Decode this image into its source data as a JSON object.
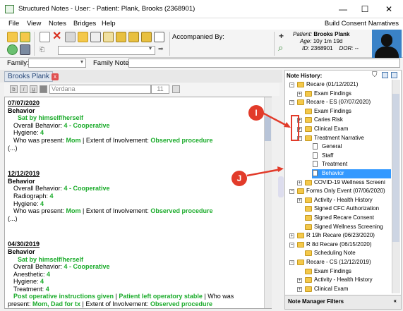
{
  "window": {
    "title": "Structured Notes - User:  - Patient: Plank, Brooks (2368901)",
    "minimize": "—",
    "maximize": "☐",
    "close": "✕"
  },
  "menu": {
    "items": [
      "File",
      "View",
      "Notes",
      "Bridges",
      "Help"
    ],
    "right_text": "Build Consent Narratives"
  },
  "toolbar": {
    "accompanied_by_label": "Accompanied By:"
  },
  "patient": {
    "patient_label": "Patient:",
    "patient_name": "Brooks Plank",
    "age_label": "Age:",
    "age_value": "10y 1m 19d",
    "id_label": "ID:",
    "id_value": "2368901",
    "dor_label": "DOR:",
    "dor_value": "--"
  },
  "family_row": {
    "family_label": "Family:",
    "family_note_label": "Family Note:"
  },
  "document_tab": {
    "label": "Brooks Plank",
    "close": "x"
  },
  "editor_toolbar": {
    "bold": "b",
    "italic": "i",
    "underline": "u",
    "font": "Verdana",
    "font_size": "11"
  },
  "notes": [
    {
      "date": "07/07/2020",
      "heading": "Behavior",
      "lines": [
        {
          "type": "green-indent",
          "text": "Sat by himself/herself"
        },
        {
          "type": "kv",
          "label": "Overall Behavior: ",
          "value": "4 - Cooperative"
        },
        {
          "type": "kv",
          "label": "Hygiene: ",
          "value": "4"
        },
        {
          "type": "kv2",
          "label": "Who was present: ",
          "value": "Mom",
          "label2": " | Extent of Involvement: ",
          "value2": "Observed procedure"
        },
        {
          "type": "plain",
          "text": "(...)"
        }
      ]
    },
    {
      "date": "12/12/2019",
      "heading": "Behavior",
      "lines": [
        {
          "type": "kv",
          "label": "Overall Behavior: ",
          "value": "4 - Cooperative"
        },
        {
          "type": "kv",
          "label": "Radiograph: ",
          "value": "4"
        },
        {
          "type": "kv",
          "label": "Hygiene: ",
          "value": "4"
        },
        {
          "type": "kv2",
          "label": "Who was present: ",
          "value": "Mom",
          "label2": " | Extent of Involvement: ",
          "value2": "Observed procedure"
        },
        {
          "type": "plain",
          "text": "(...)"
        }
      ]
    },
    {
      "date": "04/30/2019",
      "heading": "Behavior",
      "lines": [
        {
          "type": "green-indent",
          "text": "Sat by himself/herself"
        },
        {
          "type": "kv",
          "label": "Overall Behavior: ",
          "value": "4 - Cooperative"
        },
        {
          "type": "kv",
          "label": "Anesthetic: ",
          "value": "4"
        },
        {
          "type": "kv",
          "label": "Hygiene: ",
          "value": "4"
        },
        {
          "type": "kv",
          "label": "Treatment: ",
          "value": "4"
        },
        {
          "type": "post",
          "g1": "Post operative instructions given",
          "sep": " | ",
          "g2": "Patient left operatory stable",
          "tail": " | Who was"
        },
        {
          "type": "kv2nl",
          "label": "present: ",
          "value": "Mom, Dad for tx",
          "label2": " | Extent of Involvement: ",
          "value2": "Observed procedure"
        }
      ]
    }
  ],
  "note_history": {
    "label": "Note History:",
    "footer": "Note Manager Filters",
    "rows": [
      {
        "level": 0,
        "box": "⊟",
        "icon": "folder",
        "text": "Recare (01/12/2021)"
      },
      {
        "level": 1,
        "box": "⊞",
        "icon": "folder",
        "text": "Exam Findings"
      },
      {
        "level": 0,
        "box": "⊟",
        "icon": "folder",
        "text": "Recare - ES (07/07/2020)"
      },
      {
        "level": 1,
        "box": "",
        "icon": "folder",
        "text": "Exam Findings"
      },
      {
        "level": 1,
        "box": "⊞",
        "icon": "folder",
        "text": "Caries Risk"
      },
      {
        "level": 1,
        "box": "⊞",
        "icon": "folder",
        "text": "Clinical Exam"
      },
      {
        "level": 1,
        "box": "⊟",
        "icon": "folder",
        "text": "Treatment Narrative"
      },
      {
        "level": 2,
        "box": "",
        "icon": "doc",
        "text": "General"
      },
      {
        "level": 2,
        "box": "",
        "icon": "doc",
        "text": "Staff"
      },
      {
        "level": 2,
        "box": "",
        "icon": "doc",
        "text": "Treatment"
      },
      {
        "level": 2,
        "box": "",
        "icon": "doc",
        "text": "Behavior",
        "selected": true
      },
      {
        "level": 1,
        "box": "⊞",
        "icon": "folder",
        "text": "COVID-19 Wellness Screeni"
      },
      {
        "level": 0,
        "box": "⊟",
        "icon": "folder",
        "text": "Forms Only Event (07/06/2020)"
      },
      {
        "level": 1,
        "box": "⊞",
        "icon": "folder",
        "text": "Activity - Health History"
      },
      {
        "level": 1,
        "box": "",
        "icon": "folder",
        "text": "Signed CFC Authorization"
      },
      {
        "level": 1,
        "box": "",
        "icon": "folder",
        "text": "Signed Recare Consent"
      },
      {
        "level": 1,
        "box": "",
        "icon": "folder",
        "text": "Signed Wellness Screening"
      },
      {
        "level": 0,
        "box": "⊞",
        "icon": "folder",
        "text": "R 19h Recare (06/23/2020)"
      },
      {
        "level": 0,
        "box": "⊟",
        "icon": "folder",
        "text": "R 8d Recare (06/15/2020)"
      },
      {
        "level": 1,
        "box": "",
        "icon": "folder",
        "text": "Scheduling Note"
      },
      {
        "level": 0,
        "box": "⊟",
        "icon": "folder",
        "text": "Recare - CS (12/12/2019)"
      },
      {
        "level": 1,
        "box": "",
        "icon": "folder",
        "text": "Exam Findings"
      },
      {
        "level": 1,
        "box": "⊞",
        "icon": "folder",
        "text": "Activity - Health History"
      },
      {
        "level": 1,
        "box": "⊞",
        "icon": "folder",
        "text": "Clinical Exam"
      }
    ]
  },
  "callouts": {
    "i_label": "I",
    "j_label": "J",
    "color": "#e23b2a"
  },
  "colors": {
    "green_text": "#1aab2a",
    "selection": "#3399ff",
    "folder": "#f4c84a"
  }
}
